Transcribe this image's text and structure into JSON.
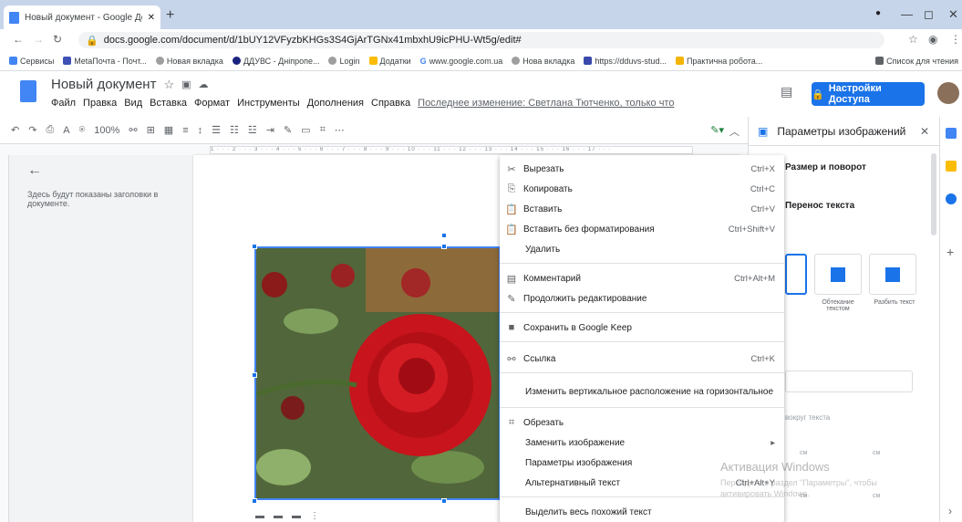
{
  "browser": {
    "tab_title": "Новый документ - Google Док",
    "url": "docs.google.com/document/d/1bUY12VFyzbKHGs3S4GjArTGNx41mbxhU9icPHU-Wt5g/edit#",
    "bookmarks": [
      "Сервисы",
      "MetaПочта - Почт...",
      "Новая вкладка",
      "ДДУВС - Днiпропе...",
      "Login",
      "Додатки",
      "www.google.com.ua",
      "Нова вкладка",
      "https://dduvs-stud...",
      "Практична робота..."
    ],
    "bookmarks_right": "Список для чтения"
  },
  "doc": {
    "title": "Новый документ",
    "menus": [
      "Файл",
      "Правка",
      "Вид",
      "Вставка",
      "Формат",
      "Инструменты",
      "Дополнения",
      "Справка"
    ],
    "last_edit": "Последнее изменение: Светлана Тютченко, только что",
    "share_label": "Настройки Доступа",
    "outline_text": "Здесь будут показаны заголовки в документе.",
    "zoom": "100%"
  },
  "panel": {
    "title": "Параметры изображений",
    "section_size": "Размер и поворот",
    "section_wrap": "Перенос текста",
    "wrap_opt2": "Обтекание текстом",
    "wrap_opt3": "Разбить текст",
    "margin_label": "вокруг текста",
    "unit": "см"
  },
  "context_menu": {
    "items": [
      {
        "icon": "✂",
        "label": "Вырезать",
        "shortcut": "Ctrl+X"
      },
      {
        "icon": "⎘",
        "label": "Копировать",
        "shortcut": "Ctrl+C"
      },
      {
        "icon": "📋",
        "label": "Вставить",
        "shortcut": "Ctrl+V"
      },
      {
        "icon": "📋",
        "label": "Вставить без форматирования",
        "shortcut": "Ctrl+Shift+V"
      },
      {
        "icon": "",
        "label": "Удалить",
        "shortcut": ""
      },
      {
        "icon": "▤",
        "label": "Комментарий",
        "shortcut": "Ctrl+Alt+M"
      },
      {
        "icon": "✎",
        "label": "Продолжить редактирование",
        "shortcut": ""
      },
      {
        "icon": "■",
        "label": "Сохранить в Google Keep",
        "shortcut": ""
      },
      {
        "icon": "⚯",
        "label": "Ссылка",
        "shortcut": "Ctrl+K"
      },
      {
        "icon": "",
        "label": "Изменить вертикальное расположение на горизонтальное",
        "shortcut": ""
      },
      {
        "icon": "⌗",
        "label": "Обрезать",
        "shortcut": ""
      },
      {
        "icon": "",
        "label": "Заменить изображение",
        "shortcut": "▸"
      },
      {
        "icon": "",
        "label": "Параметры изображения",
        "shortcut": ""
      },
      {
        "icon": "",
        "label": "Альтернативный текст",
        "shortcut": "Ctrl+Alt+Y"
      },
      {
        "icon": "",
        "label": "Выделить весь похожий текст",
        "shortcut": ""
      }
    ]
  },
  "watermark": {
    "line1": "Активация Windows",
    "line2": "Перейдите в раздел \"Параметры\", чтобы активировать Windows."
  }
}
